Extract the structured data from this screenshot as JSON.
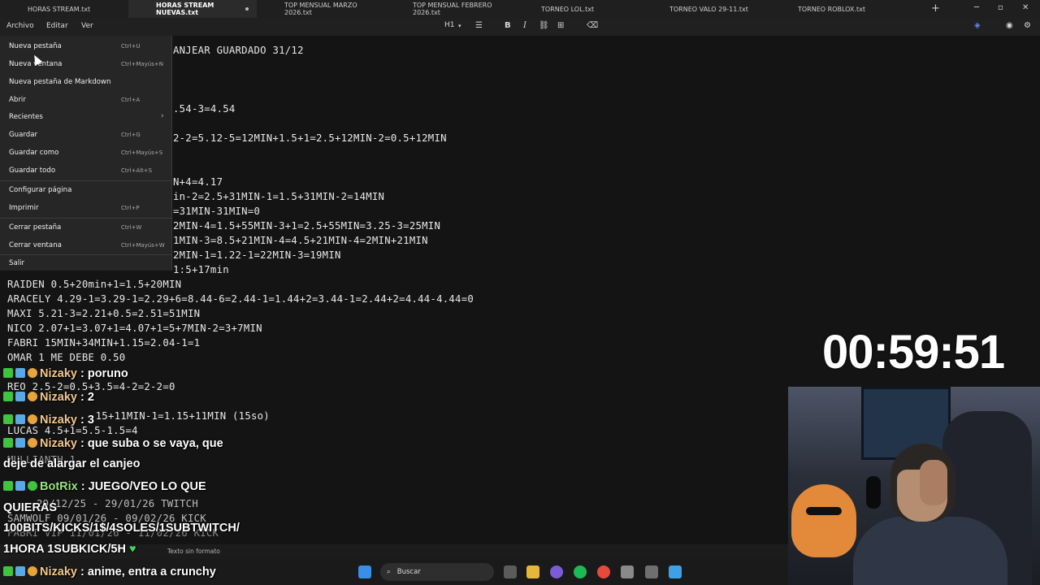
{
  "tabs": [
    {
      "label": "HORAS STREAM.txt",
      "active": false
    },
    {
      "label": "HORAS STREAM NUEVAS.txt",
      "active": true
    },
    {
      "label": "TOP MENSUAL MARZO 2026.txt",
      "active": false
    },
    {
      "label": "TOP MENSUAL FEBRERO 2026.txt",
      "active": false
    },
    {
      "label": "TORNEO LOL.txt",
      "active": false
    },
    {
      "label": "TORNEO VALO 29-11.txt",
      "active": false
    },
    {
      "label": "TORNEO ROBLOX.txt",
      "active": false
    }
  ],
  "menu": {
    "archivo": "Archivo",
    "editar": "Editar",
    "ver": "Ver"
  },
  "toolbar": {
    "heading": "H1"
  },
  "file_menu": [
    {
      "label": "Nueva pestaña",
      "shortcut": "Ctrl+U"
    },
    {
      "label": "Nueva ventana",
      "shortcut": "Ctrl+Mayús+N"
    },
    {
      "label": "Nueva pestaña de Markdown",
      "shortcut": ""
    },
    {
      "label": "Abrir",
      "shortcut": "Ctrl+A"
    },
    {
      "label": "Recientes",
      "shortcut": ""
    },
    {
      "label": "Guardar",
      "shortcut": "Ctrl+G"
    },
    {
      "label": "Guardar como",
      "shortcut": "Ctrl+Mayús+S"
    },
    {
      "label": "Guardar todo",
      "shortcut": "Ctrl+Alt+S"
    },
    {
      "label": "Configurar página",
      "shortcut": ""
    },
    {
      "label": "Imprimir",
      "shortcut": "Ctrl+P"
    },
    {
      "label": "Cerrar pestaña",
      "shortcut": "Ctrl+W"
    },
    {
      "label": "Cerrar ventana",
      "shortcut": "Ctrl+Mayús+W"
    },
    {
      "label": "Salir",
      "shortcut": ""
    }
  ],
  "editor_lines": [
    "ANJEAR GUARDADO 31/12",
    ".54-3=4.54",
    "2-2=5.12-5=12MIN+1.5+1=2.5+12MIN-2=0.5+12MIN",
    "N+4=4.17",
    "in-2=2.5+31MIN-1=1.5+31MIN-2=14MIN",
    "=31MIN-31MIN=0",
    "2MIN-4=1.5+55MIN-3+1=2.5+55MIN=3.25-3=25MIN",
    "1MIN-3=8.5+21MIN-4=4.5+21MIN-4=2MIN+21MIN",
    "2MIN-1=1.22-1=22MIN-3=19MIN",
    "1:5+17min",
    "RAIDEN 0.5+20min+1=1.5+20MIN",
    "ARACELY 4.29-1=3.29-1=2.29+6=8.44-6=2.44-1=1.44+2=3.44-1=2.44+2=4.44-4.44=0",
    "MAXI 5.21-3=2.21+0.5=2.51=51MIN",
    "NICO 2.07+1=3.07+1=4.07+1=5+7MIN-2=3+7MIN",
    "FABRI 15MIN+34MIN+1.15=2.04-1=1",
    "OMAR 1 ME DEBE 0.50",
    "REO 2.5-2=0.5+3.5=4-2=2-2=0",
    ".15+11MIN-1=1.15+11MIN (15so)",
    "LUCAS 4.5+1=5.5-1.5=4",
    "MULLIANTH 1",
    "29/12/25 - 29/01/26 TWITCH",
    "SAMWOLF 09/01/26 - 09/02/26 KICK",
    "FABRI VIP 11/01/26 - 11/02/26 KICK"
  ],
  "chat": [
    {
      "user": "Nizaky",
      "text": "poruno"
    },
    {
      "user": "Nizaky",
      "text": "2"
    },
    {
      "user": "Nizaky",
      "text": "3"
    },
    {
      "user": "Nizaky",
      "text": "que suba o se vaya, que"
    },
    {
      "continuation": "deje de alargar el canjeo"
    },
    {
      "user": "BotRix",
      "text": "JUEGO/VEO LO QUE"
    },
    {
      "continuation": "QUIERAS"
    },
    {
      "continuation": "100BITS/KICKS/1$/4SOLES/1SUBTWITCH/"
    },
    {
      "continuation": "1HORA 1SUBKICK/5H"
    },
    {
      "user": "Nizaky",
      "text": "anime, entra a crunchy"
    }
  ],
  "timer": "00:59:51",
  "status": {
    "format": "Texto sin formato"
  },
  "taskbar": {
    "search_placeholder": "Buscar"
  },
  "colors": {
    "accent": "#3ec43e",
    "chat_name": "#f2c98c"
  }
}
